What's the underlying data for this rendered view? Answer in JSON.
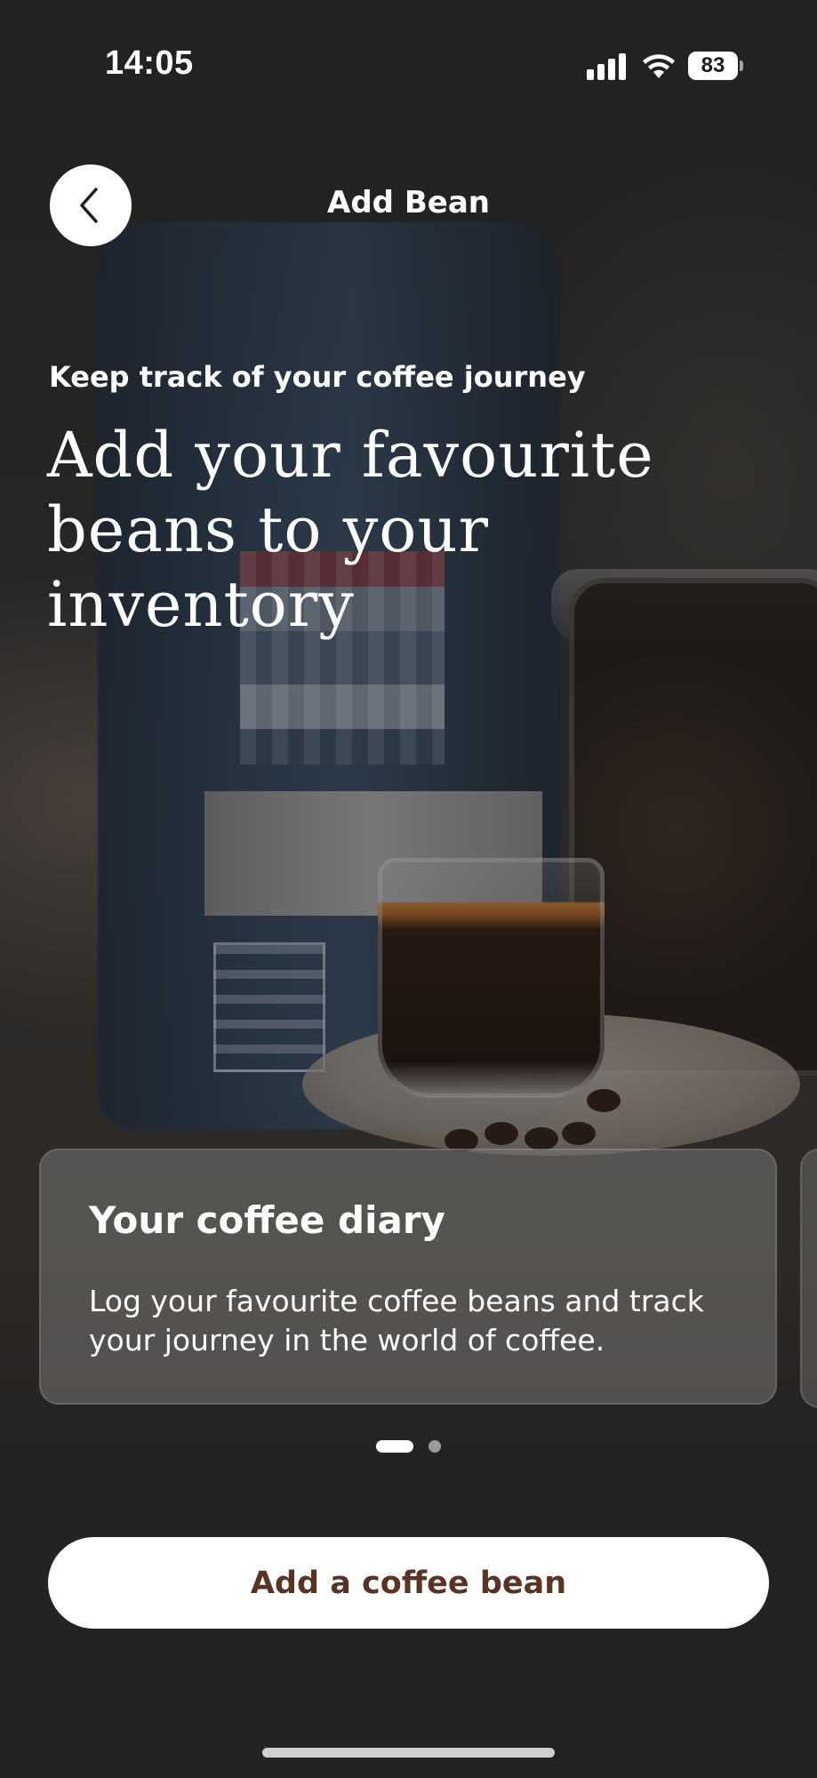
{
  "status_bar": {
    "time": "14:05",
    "battery": "83",
    "signal_icon": "cellular-signal-icon",
    "wifi_icon": "wifi-icon",
    "battery_icon": "battery-icon"
  },
  "header": {
    "title": "Add Bean",
    "back_icon": "chevron-left-icon"
  },
  "hero": {
    "subtitle": "Keep track of your coffee journey",
    "headline_line1": "Add your favourite",
    "headline_line2": "beans to your inventory"
  },
  "carousel": {
    "cards": [
      {
        "title": "Your coffee diary",
        "body_line1": "Log your favourite coffee beans and track",
        "body_line2": "your journey in the world of coffee."
      }
    ],
    "total_pages": 2,
    "active_page": 1
  },
  "cta": {
    "label": "Add a coffee bean"
  },
  "colors": {
    "background": "#232323",
    "cta_text": "#5a3422",
    "white": "#ffffff"
  }
}
